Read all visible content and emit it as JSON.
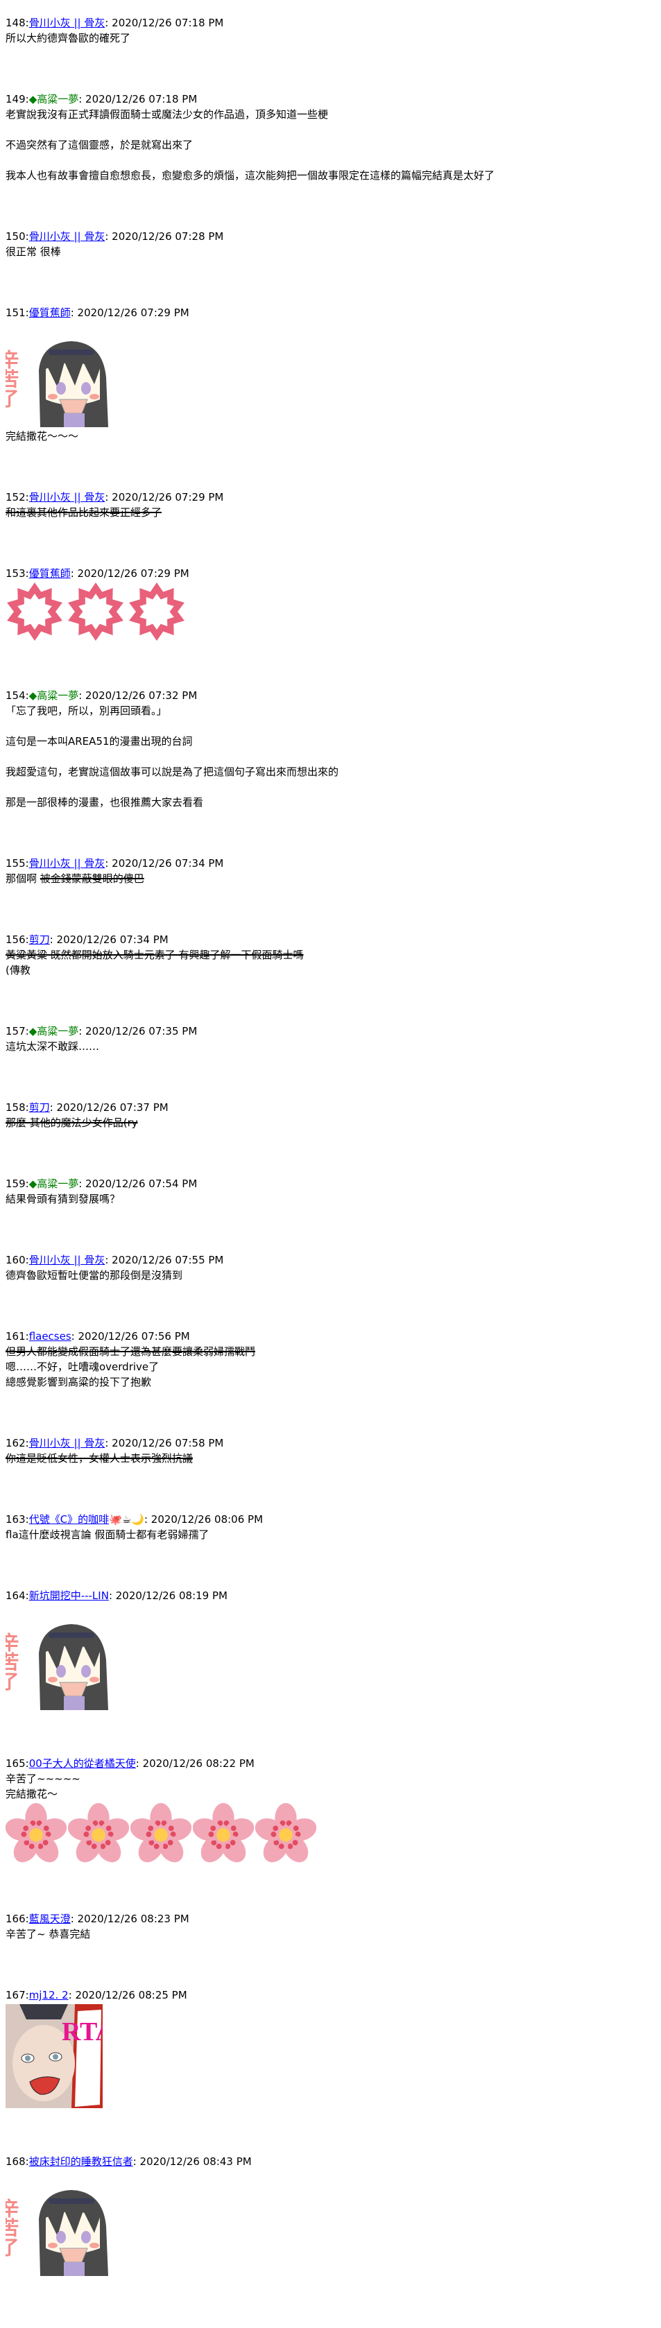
{
  "colors": {
    "link": "#0000ff",
    "green_name": "#008000",
    "sakura_outline": "#e8607a",
    "sakura_fill": "#f2a7b6",
    "sakura_dot": "#e24b62",
    "sakura_center": "#ffcc4d"
  },
  "posts": [
    {
      "no": "148:",
      "name": "骨川小灰 || 骨灰",
      "style": "link",
      "date": ": 2020/12/26 07:18 PM",
      "body": [
        [
          {
            "t": "所以大約德齊魯歐的確死了"
          }
        ]
      ]
    },
    {
      "no": "149:",
      "name": "◆高粱一夢",
      "style": "green",
      "date": ": 2020/12/26 07:18 PM",
      "body": [
        [
          {
            "t": "老實說我沒有正式拜讀假面騎士或魔法少女的作品過，頂多知道一些梗"
          }
        ],
        [],
        [
          {
            "t": "不過突然有了這個靈感，於是就寫出來了"
          }
        ],
        [],
        [
          {
            "t": "我本人也有故事會擅自愈想愈長，愈變愈多的煩惱，這次能夠把一個故事限定在這樣的篇幅完結真是太好了"
          }
        ]
      ]
    },
    {
      "no": "150:",
      "name": "骨川小灰 || 骨灰",
      "style": "link",
      "date": ": 2020/12/26 07:28 PM",
      "body": [
        [
          {
            "t": "很正常 很棒"
          }
        ]
      ]
    },
    {
      "no": "151:",
      "name": "優質蕉師",
      "style": "link",
      "date": ": 2020/12/26 07:29 PM",
      "media": {
        "type": "chibi",
        "count": 1,
        "image_text": "辛苦了"
      },
      "body": [
        [
          {
            "t": "完結撒花～～～"
          }
        ]
      ]
    },
    {
      "no": "152:",
      "name": "骨川小灰 || 骨灰",
      "style": "link",
      "date": ": 2020/12/26 07:29 PM",
      "body": [
        [
          {
            "t": "和這裏其他作品比起來要正經多了",
            "s": true
          }
        ]
      ]
    },
    {
      "no": "153:",
      "name": "優質蕉師",
      "style": "link",
      "date": ": 2020/12/26 07:29 PM",
      "media": {
        "type": "sakura-outline",
        "count": 3
      },
      "body": []
    },
    {
      "no": "154:",
      "name": "◆高粱一夢",
      "style": "green",
      "date": ": 2020/12/26 07:32 PM",
      "body": [
        [
          {
            "t": "「忘了我吧，所以，別再回頭看。」"
          }
        ],
        [],
        [
          {
            "t": "這句是一本叫AREA51的漫畫出現的台詞"
          }
        ],
        [],
        [
          {
            "t": "我超愛這句，老實說這個故事可以說是為了把這個句子寫出來而想出來的"
          }
        ],
        [],
        [
          {
            "t": "那是一部很棒的漫畫，也很推薦大家去看看"
          }
        ]
      ]
    },
    {
      "no": "155:",
      "name": "骨川小灰 || 骨灰",
      "style": "link",
      "date": ": 2020/12/26 07:34 PM",
      "body": [
        [
          {
            "t": "那個啊 "
          },
          {
            "t": "被金錢蒙蔽雙眼的傻巴",
            "s": true
          }
        ]
      ]
    },
    {
      "no": "156:",
      "name": "剪刀",
      "style": "link",
      "date": ": 2020/12/26 07:34 PM",
      "body": [
        [
          {
            "t": "黃粱黃粱 既然都開始放入騎士元素了 有興趣了解一下假面騎士嗎",
            "s": true
          }
        ],
        [
          {
            "t": "(傳教"
          }
        ]
      ]
    },
    {
      "no": "157:",
      "name": "◆高粱一夢",
      "style": "green",
      "date": ": 2020/12/26 07:35 PM",
      "body": [
        [
          {
            "t": "這坑太深不敢踩……"
          }
        ]
      ]
    },
    {
      "no": "158:",
      "name": "剪刀",
      "style": "link",
      "date": ": 2020/12/26 07:37 PM",
      "body": [
        [
          {
            "t": "那麼 其他的魔法少女作品(ry",
            "s": true
          }
        ]
      ]
    },
    {
      "no": "159:",
      "name": "◆高粱一夢",
      "style": "green",
      "date": ": 2020/12/26 07:54 PM",
      "body": [
        [
          {
            "t": "結果骨頭有猜到發展嗎？"
          }
        ]
      ]
    },
    {
      "no": "160:",
      "name": "骨川小灰 || 骨灰",
      "style": "link",
      "date": ": 2020/12/26 07:55 PM",
      "body": [
        [
          {
            "t": "德齊魯歐短暫吐便當的那段倒是沒猜到"
          }
        ]
      ]
    },
    {
      "no": "161:",
      "name": "flaecses",
      "style": "link",
      "date": ": 2020/12/26 07:56 PM",
      "body": [
        [
          {
            "t": "但男人都能變成假面騎士了還為甚麼要讓柔弱婦孺戰鬥",
            "s": true
          }
        ],
        [
          {
            "t": "嗯……不好，吐嘈魂overdrive了"
          }
        ],
        [
          {
            "t": "總感覺影響到高粱的投下了抱歉"
          }
        ]
      ]
    },
    {
      "no": "162:",
      "name": "骨川小灰 || 骨灰",
      "style": "link",
      "date": ": 2020/12/26 07:58 PM",
      "body": [
        [
          {
            "t": "你這是貶低女性，女權人士表示強烈抗議",
            "s": true
          }
        ]
      ]
    },
    {
      "no": "163:",
      "name": "代號《C》的咖啡",
      "style": "link",
      "emoji": "🐙☕🌙",
      "date": ": 2020/12/26 08:06 PM",
      "body": [
        [
          {
            "t": "fla這什麼歧視言論 假面騎士都有老弱婦孺了"
          }
        ]
      ]
    },
    {
      "no": "164:",
      "name": "新坑開挖中---LIN",
      "style": "link",
      "date": ": 2020/12/26 08:19 PM",
      "media": {
        "type": "chibi",
        "count": 1,
        "image_text": "辛苦了"
      },
      "body": []
    },
    {
      "no": "165:",
      "name": "00子大人的從者橘天使",
      "style": "link",
      "date": ": 2020/12/26 08:22 PM",
      "body": [
        [
          {
            "t": "辛苦了~~~~~"
          }
        ],
        [
          {
            "t": "完結撒花～"
          }
        ]
      ],
      "media_after": {
        "type": "sakura",
        "count": 5
      }
    },
    {
      "no": "166:",
      "name": "藍風天澄",
      "style": "link",
      "date": ": 2020/12/26 08:23 PM",
      "body": [
        [
          {
            "t": "辛苦了~ 恭喜完結"
          }
        ]
      ]
    },
    {
      "no": "167:",
      "name": "mj12. 2",
      "style": "link",
      "date": ": 2020/12/26 08:25 PM",
      "media": {
        "type": "rta",
        "count": 1,
        "image_text": "RTA"
      },
      "body": []
    },
    {
      "no": "168:",
      "name": "被床封印的睡教狂信者",
      "style": "link",
      "date": ": 2020/12/26 08:43 PM",
      "media": {
        "type": "chibi",
        "count": 1,
        "image_text": "辛苦了"
      },
      "body": []
    }
  ]
}
